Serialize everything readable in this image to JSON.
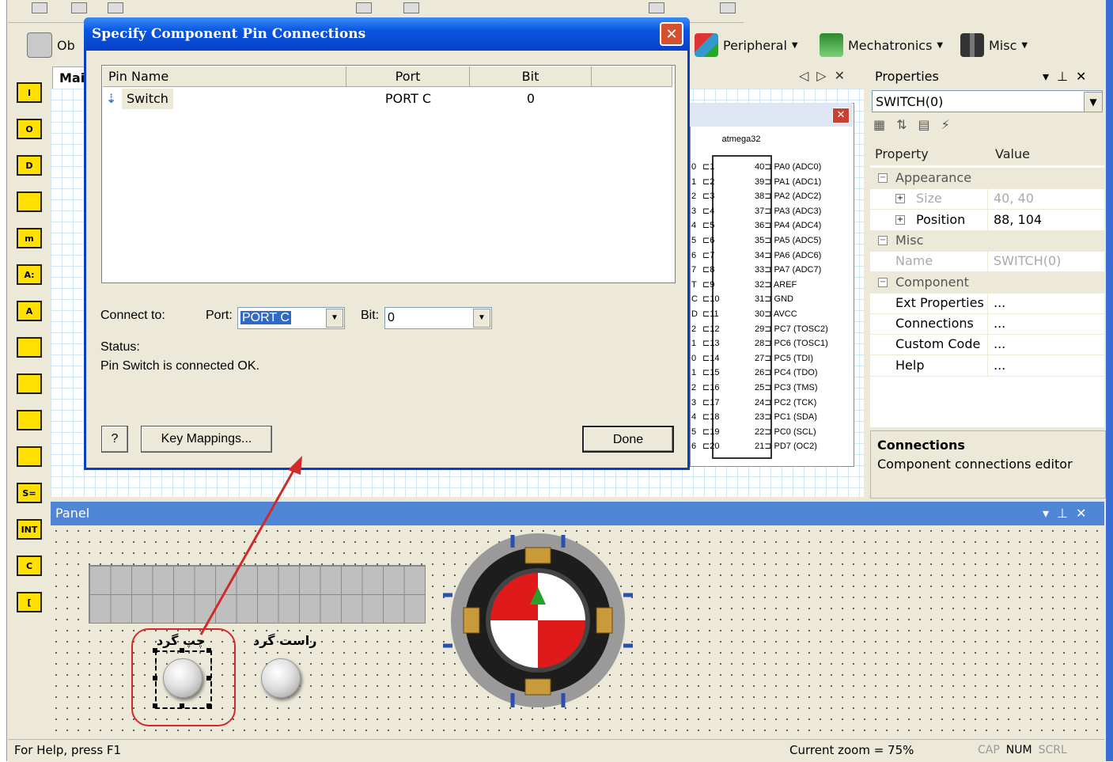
{
  "toolbar": {
    "peripheral": "Peripheral",
    "mechatronics": "Mechatronics",
    "misc": "Misc",
    "objects_partial": "Ob"
  },
  "document": {
    "tab": "Mai"
  },
  "chip": {
    "title": "atmega32",
    "left_pins": [
      {
        "edge": "0",
        "num": "1"
      },
      {
        "edge": "1",
        "num": "2"
      },
      {
        "edge": "2",
        "num": "3"
      },
      {
        "edge": "3",
        "num": "4"
      },
      {
        "edge": "4",
        "num": "5"
      },
      {
        "edge": "5",
        "num": "6"
      },
      {
        "edge": "6",
        "num": "7"
      },
      {
        "edge": "7",
        "num": "8"
      },
      {
        "edge": "T",
        "num": "9"
      },
      {
        "edge": "C",
        "num": "10"
      },
      {
        "edge": "D",
        "num": "11"
      },
      {
        "edge": "2",
        "num": "12"
      },
      {
        "edge": "1",
        "num": "13"
      },
      {
        "edge": "0",
        "num": "14"
      },
      {
        "edge": "1",
        "num": "15"
      },
      {
        "edge": "2",
        "num": "16"
      },
      {
        "edge": "3",
        "num": "17"
      },
      {
        "edge": "4",
        "num": "18"
      },
      {
        "edge": "5",
        "num": "19"
      },
      {
        "edge": "6",
        "num": "20"
      }
    ],
    "right_pins": [
      {
        "num": "40",
        "name": "PA0 (ADC0)"
      },
      {
        "num": "39",
        "name": "PA1 (ADC1)"
      },
      {
        "num": "38",
        "name": "PA2 (ADC2)"
      },
      {
        "num": "37",
        "name": "PA3 (ADC3)"
      },
      {
        "num": "36",
        "name": "PA4 (ADC4)"
      },
      {
        "num": "35",
        "name": "PA5 (ADC5)"
      },
      {
        "num": "34",
        "name": "PA6 (ADC6)"
      },
      {
        "num": "33",
        "name": "PA7 (ADC7)"
      },
      {
        "num": "32",
        "name": "AREF"
      },
      {
        "num": "31",
        "name": "GND"
      },
      {
        "num": "30",
        "name": "AVCC"
      },
      {
        "num": "29",
        "name": "PC7 (TOSC2)"
      },
      {
        "num": "28",
        "name": "PC6 (TOSC1)"
      },
      {
        "num": "27",
        "name": "PC5 (TDI)"
      },
      {
        "num": "26",
        "name": "PC4 (TDO)"
      },
      {
        "num": "25",
        "name": "PC3 (TMS)"
      },
      {
        "num": "24",
        "name": "PC2 (TCK)"
      },
      {
        "num": "23",
        "name": "PC1 (SDA)"
      },
      {
        "num": "22",
        "name": "PC0 (SCL)"
      },
      {
        "num": "21",
        "name": "PD7 (OC2)"
      }
    ]
  },
  "properties": {
    "header": "Properties",
    "selected_object": "SWITCH(0)",
    "col_property": "Property",
    "col_value": "Value",
    "rows": [
      {
        "name": "Appearance",
        "value": "",
        "kind": "category"
      },
      {
        "name": "Size",
        "value": "40, 40",
        "kind": "disabled-expand"
      },
      {
        "name": "Position",
        "value": "88, 104",
        "kind": "expand"
      },
      {
        "name": "Misc",
        "value": "",
        "kind": "category"
      },
      {
        "name": "Name",
        "value": "SWITCH(0)",
        "kind": "disabled"
      },
      {
        "name": "Component",
        "value": "",
        "kind": "category"
      },
      {
        "name": "Ext Properties",
        "value": "...",
        "kind": "item"
      },
      {
        "name": "Connections",
        "value": "...",
        "kind": "item"
      },
      {
        "name": "Custom Code",
        "value": "...",
        "kind": "item"
      },
      {
        "name": "Help",
        "value": "...",
        "kind": "item"
      }
    ],
    "desc_title": "Connections",
    "desc_text": "Component connections editor"
  },
  "panel": {
    "title": "Panel",
    "left_button_label": "چپ گرد",
    "right_button_label": "راست گرد"
  },
  "dialog": {
    "title": "Specify Component Pin Connections",
    "columns": [
      "Pin Name",
      "Port",
      "Bit"
    ],
    "pins": [
      {
        "name": "Switch",
        "port": "PORT C",
        "bit": "0"
      }
    ],
    "connect_to": "Connect to:",
    "port_label": "Port:",
    "port_value": "PORT C",
    "bit_label": "Bit:",
    "bit_value": "0",
    "status_label": "Status:",
    "status_text": "Pin Switch is connected OK.",
    "help_button": "?",
    "key_mappings_button": "Key Mappings...",
    "done_button": "Done"
  },
  "statusbar": {
    "help": "For Help, press F1",
    "zoom": "Current zoom = 75%",
    "cap": "CAP",
    "num": "NUM",
    "scrl": "SCRL"
  },
  "flowchart_icons": [
    "I",
    "O",
    "D",
    "",
    "m",
    "A:",
    "A",
    "",
    "",
    "",
    "",
    "S=",
    "INT",
    "C",
    "["
  ],
  "colors": {
    "titlebar": "#0a55e0",
    "panel_header": "#4f86d6",
    "accent_red": "#d02a2a",
    "icon_yellow": "#ffe000"
  }
}
